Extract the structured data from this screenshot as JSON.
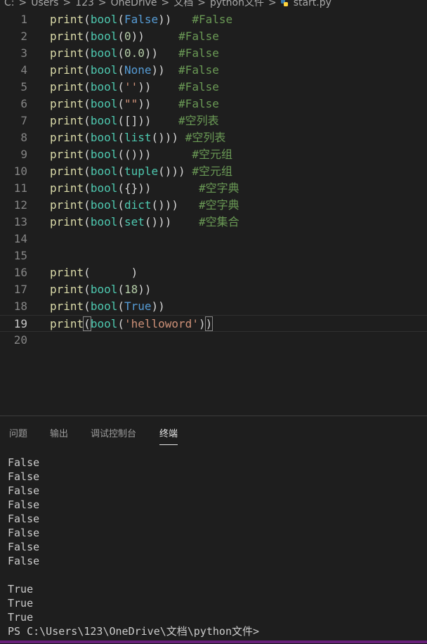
{
  "breadcrumb": {
    "items": [
      "C:",
      "Users",
      "123",
      "OneDrive",
      "文档",
      "python文件"
    ],
    "separator": ">",
    "file": "start.py"
  },
  "editor": {
    "active_line": 19,
    "lines": [
      {
        "n": "1",
        "t": [
          [
            "fn",
            "print"
          ],
          [
            "pn",
            "("
          ],
          [
            "bi",
            "bool"
          ],
          [
            "pn",
            "("
          ],
          [
            "kw",
            "False"
          ],
          [
            "pn",
            "))"
          ],
          [
            "pn",
            "   "
          ],
          [
            "cm",
            "#False"
          ]
        ]
      },
      {
        "n": "2",
        "t": [
          [
            "fn",
            "print"
          ],
          [
            "pn",
            "("
          ],
          [
            "bi",
            "bool"
          ],
          [
            "pn",
            "("
          ],
          [
            "num",
            "0"
          ],
          [
            "pn",
            "))"
          ],
          [
            "pn",
            "     "
          ],
          [
            "cm",
            "#False"
          ]
        ]
      },
      {
        "n": "3",
        "t": [
          [
            "fn",
            "print"
          ],
          [
            "pn",
            "("
          ],
          [
            "bi",
            "bool"
          ],
          [
            "pn",
            "("
          ],
          [
            "num",
            "0.0"
          ],
          [
            "pn",
            "))"
          ],
          [
            "pn",
            "   "
          ],
          [
            "cm",
            "#False"
          ]
        ]
      },
      {
        "n": "4",
        "t": [
          [
            "fn",
            "print"
          ],
          [
            "pn",
            "("
          ],
          [
            "bi",
            "bool"
          ],
          [
            "pn",
            "("
          ],
          [
            "kw",
            "None"
          ],
          [
            "pn",
            "))"
          ],
          [
            "pn",
            "  "
          ],
          [
            "cm",
            "#False"
          ]
        ]
      },
      {
        "n": "5",
        "t": [
          [
            "fn",
            "print"
          ],
          [
            "pn",
            "("
          ],
          [
            "bi",
            "bool"
          ],
          [
            "pn",
            "("
          ],
          [
            "str",
            "''"
          ],
          [
            "pn",
            "))"
          ],
          [
            "pn",
            "    "
          ],
          [
            "cm",
            "#False"
          ]
        ]
      },
      {
        "n": "6",
        "t": [
          [
            "fn",
            "print"
          ],
          [
            "pn",
            "("
          ],
          [
            "bi",
            "bool"
          ],
          [
            "pn",
            "("
          ],
          [
            "str",
            "\"\""
          ],
          [
            "pn",
            "))"
          ],
          [
            "pn",
            "    "
          ],
          [
            "cm",
            "#False"
          ]
        ]
      },
      {
        "n": "7",
        "t": [
          [
            "fn",
            "print"
          ],
          [
            "pn",
            "("
          ],
          [
            "bi",
            "bool"
          ],
          [
            "pn",
            "([]))"
          ],
          [
            "pn",
            "    "
          ],
          [
            "cm",
            "#空列表"
          ]
        ]
      },
      {
        "n": "8",
        "t": [
          [
            "fn",
            "print"
          ],
          [
            "pn",
            "("
          ],
          [
            "bi",
            "bool"
          ],
          [
            "pn",
            "("
          ],
          [
            "bi",
            "list"
          ],
          [
            "pn",
            "()))"
          ],
          [
            "pn",
            " "
          ],
          [
            "cm",
            "#空列表"
          ]
        ]
      },
      {
        "n": "9",
        "t": [
          [
            "fn",
            "print"
          ],
          [
            "pn",
            "("
          ],
          [
            "bi",
            "bool"
          ],
          [
            "pn",
            "(()))"
          ],
          [
            "pn",
            "      "
          ],
          [
            "cm",
            "#空元组"
          ]
        ]
      },
      {
        "n": "10",
        "t": [
          [
            "fn",
            "print"
          ],
          [
            "pn",
            "("
          ],
          [
            "bi",
            "bool"
          ],
          [
            "pn",
            "("
          ],
          [
            "bi",
            "tuple"
          ],
          [
            "pn",
            "()))"
          ],
          [
            "pn",
            " "
          ],
          [
            "cm",
            "#空元组"
          ]
        ]
      },
      {
        "n": "11",
        "t": [
          [
            "fn",
            "print"
          ],
          [
            "pn",
            "("
          ],
          [
            "bi",
            "bool"
          ],
          [
            "pn",
            "({}))"
          ],
          [
            "pn",
            "       "
          ],
          [
            "cm",
            "#空字典"
          ]
        ]
      },
      {
        "n": "12",
        "t": [
          [
            "fn",
            "print"
          ],
          [
            "pn",
            "("
          ],
          [
            "bi",
            "bool"
          ],
          [
            "pn",
            "("
          ],
          [
            "bi",
            "dict"
          ],
          [
            "pn",
            "()))"
          ],
          [
            "pn",
            "   "
          ],
          [
            "cm",
            "#空字典"
          ]
        ]
      },
      {
        "n": "13",
        "t": [
          [
            "fn",
            "print"
          ],
          [
            "pn",
            "("
          ],
          [
            "bi",
            "bool"
          ],
          [
            "pn",
            "("
          ],
          [
            "bi",
            "set"
          ],
          [
            "pn",
            "()))"
          ],
          [
            "pn",
            "    "
          ],
          [
            "cm",
            "#空集合"
          ]
        ]
      },
      {
        "n": "14",
        "t": []
      },
      {
        "n": "15",
        "t": []
      },
      {
        "n": "16",
        "t": [
          [
            "fn",
            "print"
          ],
          [
            "pn",
            "(      )"
          ]
        ]
      },
      {
        "n": "17",
        "t": [
          [
            "fn",
            "print"
          ],
          [
            "pn",
            "("
          ],
          [
            "bi",
            "bool"
          ],
          [
            "pn",
            "("
          ],
          [
            "num",
            "18"
          ],
          [
            "pn",
            "))"
          ]
        ]
      },
      {
        "n": "18",
        "t": [
          [
            "fn",
            "print"
          ],
          [
            "pn",
            "("
          ],
          [
            "bi",
            "bool"
          ],
          [
            "pn",
            "("
          ],
          [
            "kw",
            "True"
          ],
          [
            "pn",
            "))"
          ]
        ]
      },
      {
        "n": "19",
        "t": [
          [
            "fn",
            "print"
          ],
          [
            "bm",
            "("
          ],
          [
            "bi",
            "bool"
          ],
          [
            "pn",
            "("
          ],
          [
            "str",
            "'helloword'"
          ],
          [
            "pn",
            ")"
          ],
          [
            "bm",
            ")"
          ]
        ]
      },
      {
        "n": "20",
        "t": []
      }
    ]
  },
  "panel": {
    "tabs": [
      {
        "label": "问题",
        "active": false
      },
      {
        "label": "输出",
        "active": false
      },
      {
        "label": "调试控制台",
        "active": false
      },
      {
        "label": "终端",
        "active": true
      }
    ]
  },
  "terminal": {
    "lines": [
      "False",
      "False",
      "False",
      "False",
      "False",
      "False",
      "False",
      "False",
      "",
      "True",
      "True",
      "True"
    ],
    "prompt": "PS C:\\Users\\123\\OneDrive\\文档\\python文件>"
  },
  "colors": {
    "background": "#1e1e1e",
    "function": "#dcdcaa",
    "builtin": "#4ec9b0",
    "keyword": "#569cd6",
    "number": "#b5cea8",
    "string": "#ce9178",
    "comment": "#6a9955",
    "status_bar": "#68217a"
  }
}
